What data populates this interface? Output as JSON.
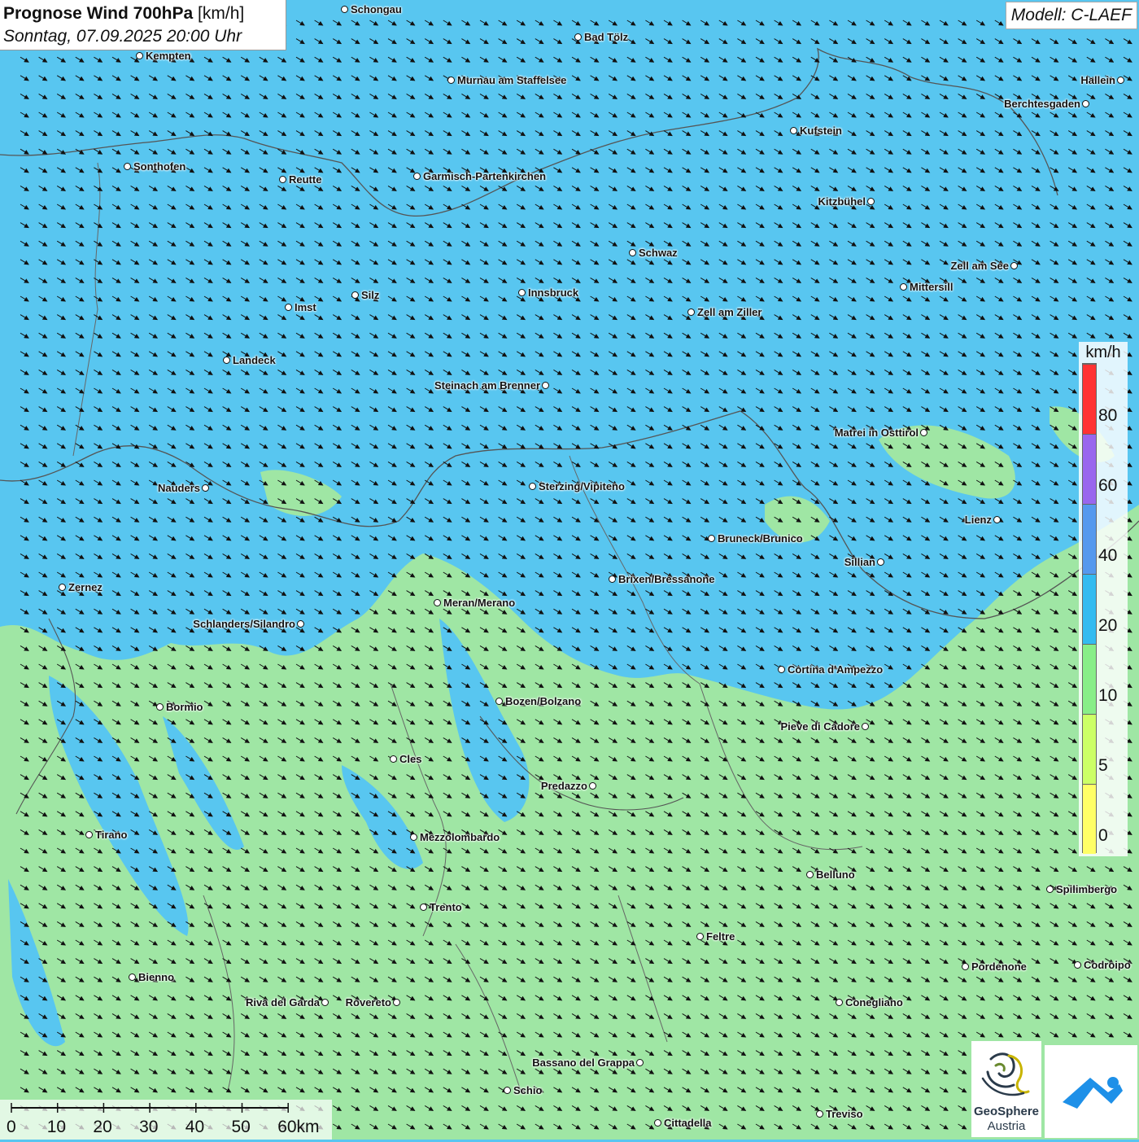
{
  "header": {
    "title_bold": "Prognose Wind 700hPa",
    "title_unit": " [km/h]",
    "subtitle": "Sonntag, 07.09.2025 20:00 Uhr"
  },
  "model_label": "Modell: C-LAEF",
  "legend": {
    "unit": "km/h",
    "ticks": [
      "0",
      "5",
      "10",
      "20",
      "40",
      "60",
      "80"
    ],
    "colors": [
      "#ffff66",
      "#ccff66",
      "#88ee88",
      "#33bbf0",
      "#5599ee",
      "#9966ee",
      "#ff3333"
    ]
  },
  "scale": {
    "labels": [
      "0",
      "10",
      "20",
      "30",
      "40",
      "50",
      "60km"
    ]
  },
  "logo": {
    "name_line1": "GeoSphere",
    "name_line2": "Austria"
  },
  "colors": {
    "blue_zone": "#58c6f0",
    "green_zone": "#9fe6a4",
    "border": "#555555"
  },
  "cities": [
    {
      "name": "Schongau"
    },
    {
      "name": "Bad Tölz"
    },
    {
      "name": "Kempten"
    },
    {
      "name": "Murnau am Staffelsee"
    },
    {
      "name": "Hallein"
    },
    {
      "name": "Berchtesgaden"
    },
    {
      "name": "Kufstein"
    },
    {
      "name": "Sonthofen"
    },
    {
      "name": "Reutte"
    },
    {
      "name": "Garmisch-Partenkirchen"
    },
    {
      "name": "Kitzbühel"
    },
    {
      "name": "Schwaz"
    },
    {
      "name": "Zell am See"
    },
    {
      "name": "Mittersill"
    },
    {
      "name": "Innsbruck"
    },
    {
      "name": "Silz"
    },
    {
      "name": "Imst"
    },
    {
      "name": "Zell am Ziller"
    },
    {
      "name": "Landeck"
    },
    {
      "name": "Steinach am Brenner"
    },
    {
      "name": "Matrei in Osttirol"
    },
    {
      "name": "Nauders"
    },
    {
      "name": "Sterzing/Vipiteno"
    },
    {
      "name": "Lienz"
    },
    {
      "name": "Bruneck/Brunico"
    },
    {
      "name": "Sillian"
    },
    {
      "name": "Zernez"
    },
    {
      "name": "Brixen/Bressanone"
    },
    {
      "name": "Meran/Merano"
    },
    {
      "name": "Schlanders/Silandro"
    },
    {
      "name": "Cortina d'Ampezzo"
    },
    {
      "name": "Bozen/Bolzano"
    },
    {
      "name": "Bormio"
    },
    {
      "name": "Pieve di Cadore"
    },
    {
      "name": "Cles"
    },
    {
      "name": "Predazzo"
    },
    {
      "name": "Tirano"
    },
    {
      "name": "Mezzolombardo"
    },
    {
      "name": "Belluno"
    },
    {
      "name": "Spilimbergo"
    },
    {
      "name": "Trento"
    },
    {
      "name": "Feltre"
    },
    {
      "name": "Pordenone"
    },
    {
      "name": "Codroipo"
    },
    {
      "name": "Bienno"
    },
    {
      "name": "Riva del Garda"
    },
    {
      "name": "Rovereto"
    },
    {
      "name": "Conegliano"
    },
    {
      "name": "Bassano del Grappa"
    },
    {
      "name": "Schio"
    },
    {
      "name": "Treviso"
    },
    {
      "name": "Cittadella"
    }
  ]
}
